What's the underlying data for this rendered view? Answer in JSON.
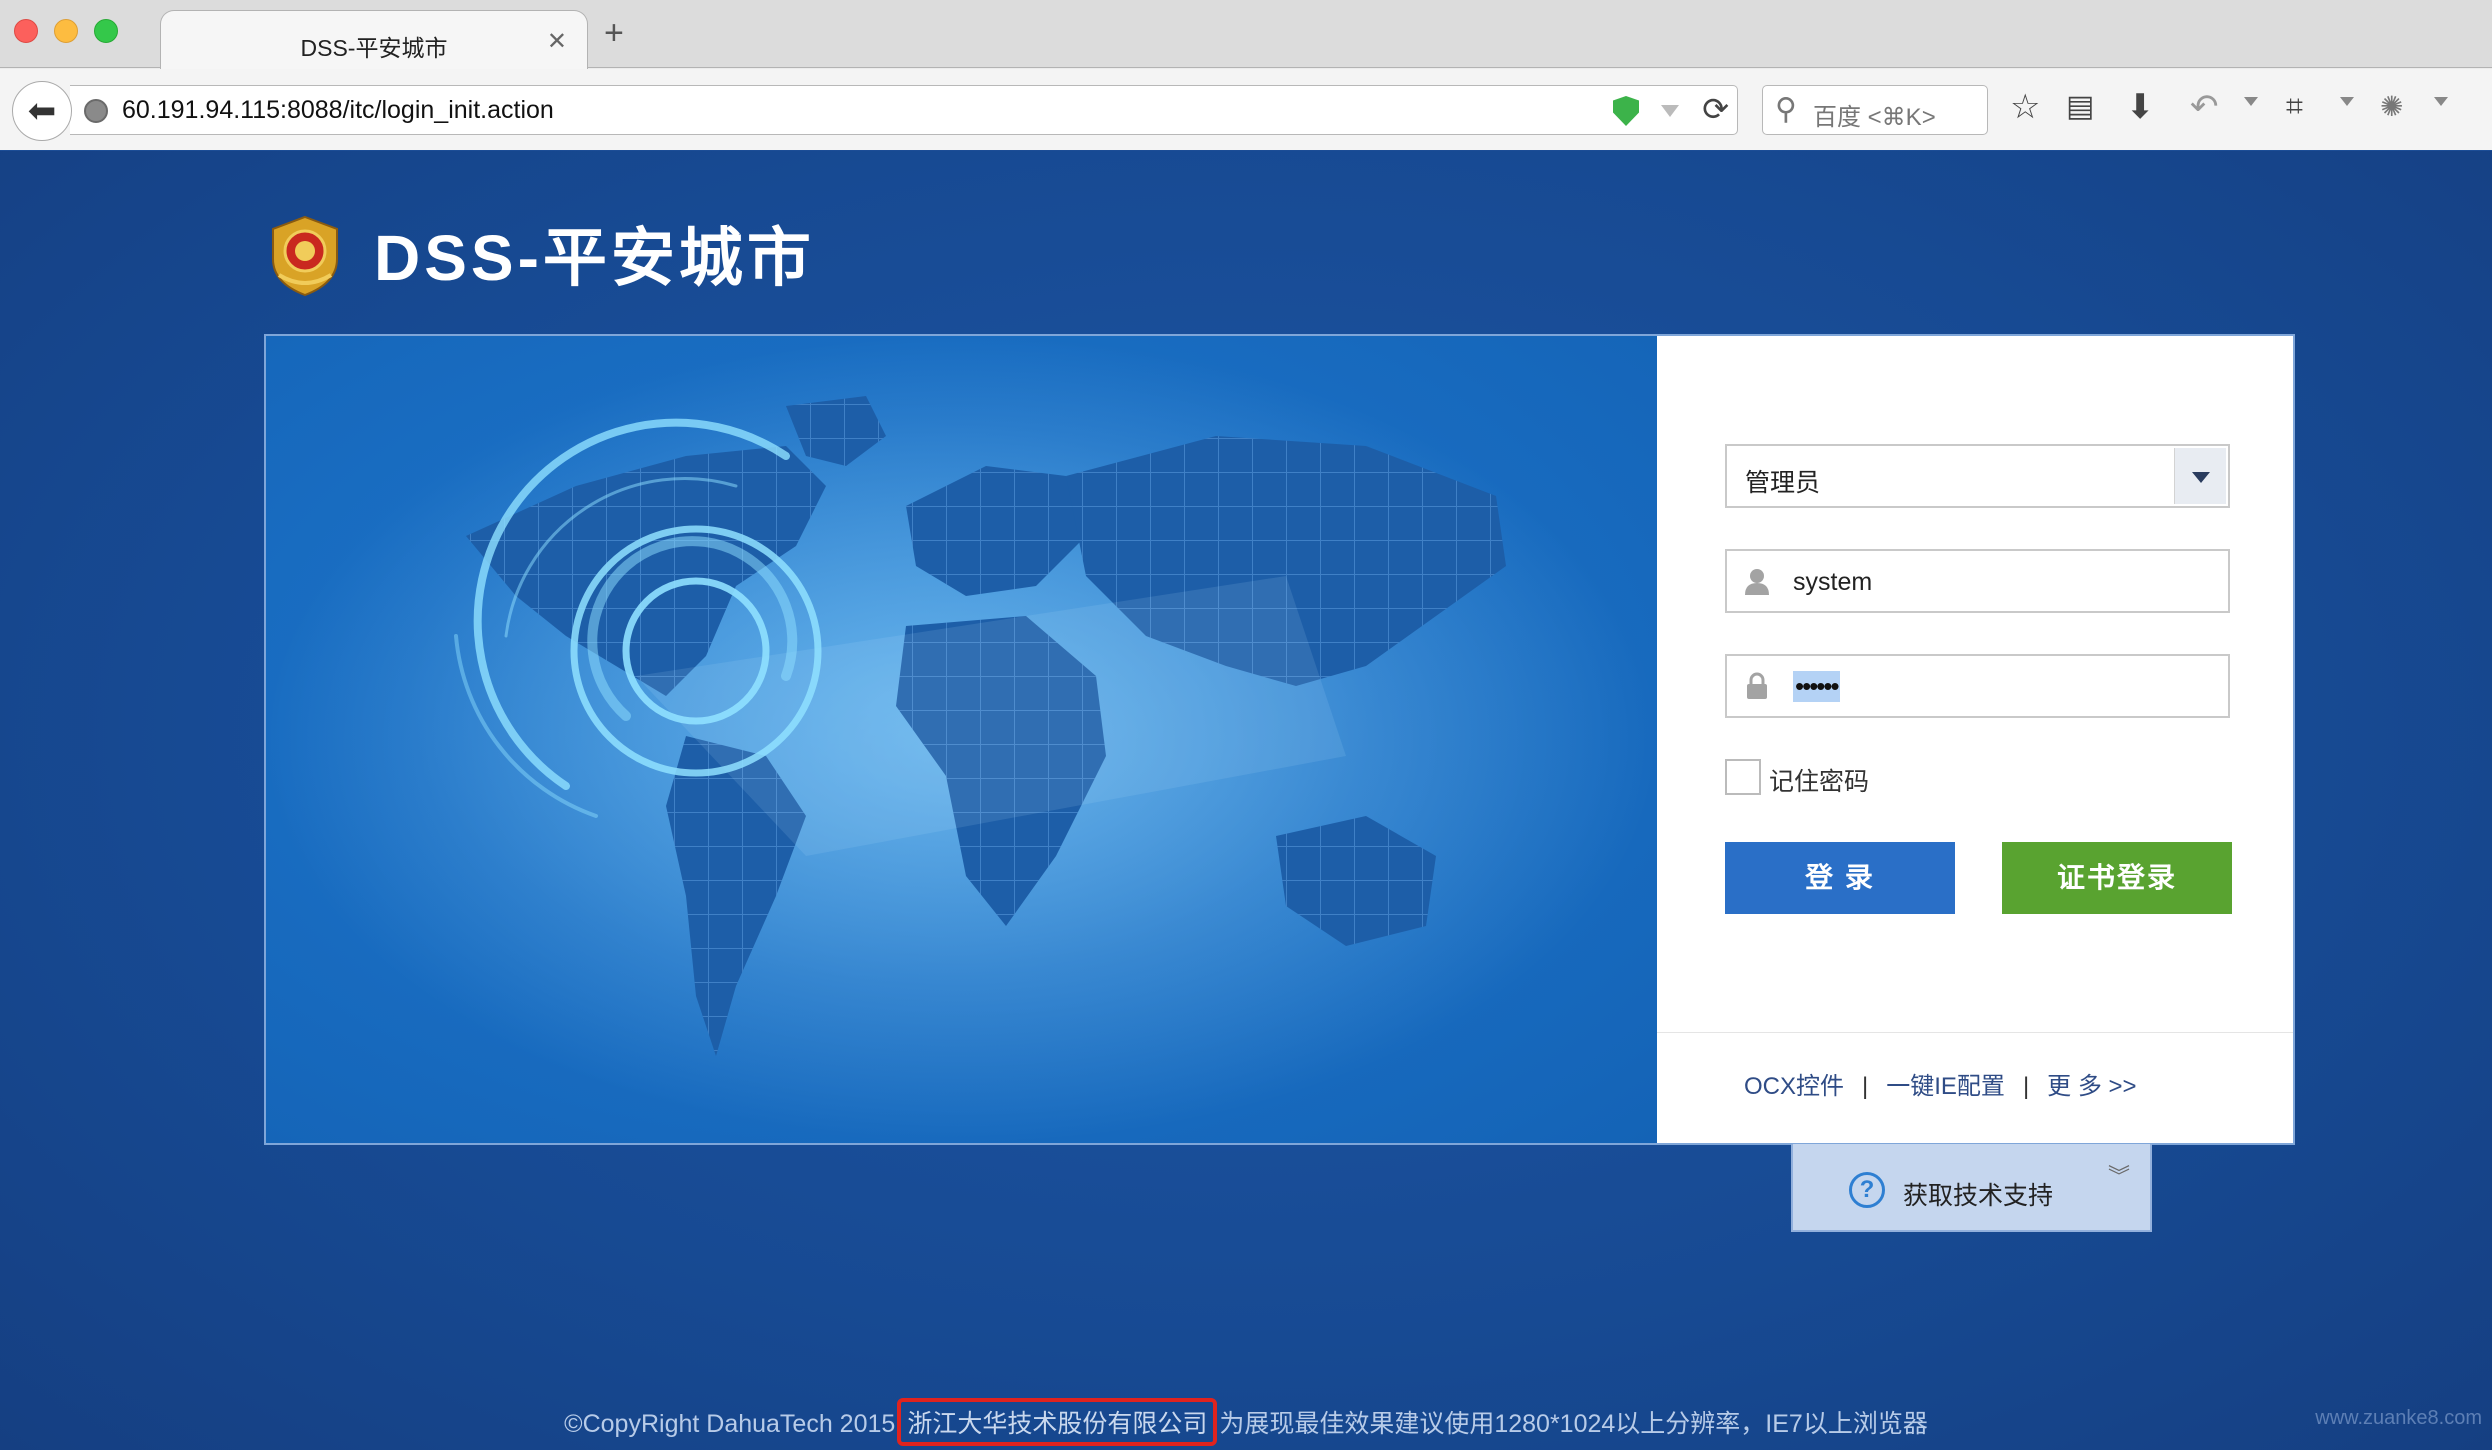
{
  "browser": {
    "tab_title": "DSS-平安城市",
    "tab_close": "✕",
    "new_tab": "+",
    "url": "60.191.94.115:8088/itc/login_init.action",
    "search_placeholder": "百度 <⌘K>",
    "icons": [
      "back-icon",
      "globe-icon",
      "shield-icon",
      "reload-icon",
      "search-icon",
      "star-icon",
      "reading-list-icon",
      "download-icon",
      "undo-icon",
      "crop-icon",
      "extension-icon"
    ]
  },
  "page": {
    "title": "DSS-平安城市",
    "emblem": "police-emblem-icon"
  },
  "login": {
    "role_selected": "管理员",
    "username": "system",
    "password_mask": "••••••",
    "remember_label": "记住密码",
    "remember_checked": false,
    "login_button": "登 录",
    "cert_login_button": "证书登录",
    "links": {
      "ocx": "OCX控件",
      "sep1": "|",
      "ie_config": "一键IE配置",
      "sep2": "|",
      "more": "更 多 >>"
    }
  },
  "support": {
    "label": "获取技术支持",
    "icon_glyph": "?",
    "chevron": "≫"
  },
  "footer": {
    "prefix": "©CopyRight DahuaTech 2015",
    "company": "浙江大华技术股份有限公司",
    "suffix": "为展现最佳效果建议使用1280*1024以上分辨率，IE7以上浏览器",
    "watermark": "www.zuanke8.com"
  },
  "colors": {
    "page_bg": "#1c4d96",
    "login_btn": "#2a6fc7",
    "cert_btn": "#59a330",
    "highlight": "#e0231e"
  }
}
